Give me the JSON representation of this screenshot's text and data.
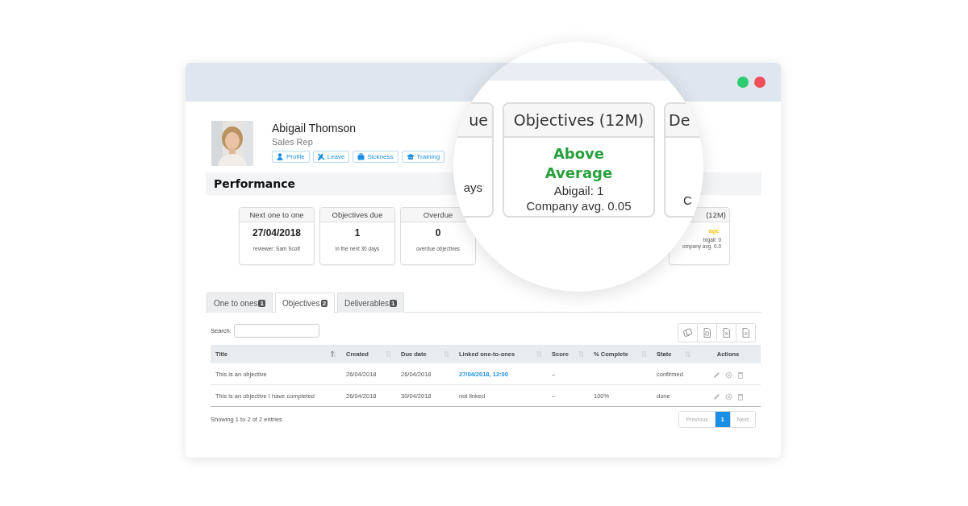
{
  "window": {
    "controls": [
      {
        "color": "#2ecc71"
      },
      {
        "color": "#f0505a"
      }
    ]
  },
  "profile": {
    "name": "Abigail Thomson",
    "role": "Sales Rep",
    "buttons": [
      {
        "label": "Profile"
      },
      {
        "label": "Leave"
      },
      {
        "label": "Sickness"
      },
      {
        "label": "Training"
      }
    ]
  },
  "performance": {
    "title": "Performance",
    "cards": [
      {
        "header": "Next one to one",
        "value": "27/04/2018",
        "note": "reviewer: Sam Scott"
      },
      {
        "header": "Objectives due",
        "value": "1",
        "note": "in the next 30 days"
      },
      {
        "header": "Overdue",
        "value": "0",
        "note": "overdue objectives"
      }
    ],
    "partial_card": {
      "header": "(12M)",
      "value": "age",
      "lines": [
        "bigail: 0",
        "ompany avg. 0.0"
      ]
    },
    "magnifier": {
      "left_card": {
        "header": "ue",
        "lines": [
          "ays"
        ]
      },
      "center_card": {
        "header": "Objectives (12M)",
        "value": "Above Average",
        "lines": [
          "Abigail: 1",
          "Company avg. 0.05"
        ]
      },
      "right_card": {
        "header": "De",
        "lines": [
          "C"
        ]
      }
    }
  },
  "tabs": [
    {
      "label": "One to ones",
      "count": "1",
      "selected": false
    },
    {
      "label": "Objectives",
      "count": "2",
      "selected": true
    },
    {
      "label": "Deliverables",
      "count": "1",
      "selected": false
    }
  ],
  "table": {
    "search_label": "Search:",
    "columns": [
      {
        "label": "Title",
        "sorted": true
      },
      {
        "label": "Created",
        "sorted": false
      },
      {
        "label": "Due date",
        "sorted": false
      },
      {
        "label": "Linked one-to-ones",
        "sorted": false
      },
      {
        "label": "Score",
        "sorted": false
      },
      {
        "label": "% Complete",
        "sorted": false
      },
      {
        "label": "State",
        "sorted": false
      },
      {
        "label": "Actions"
      }
    ],
    "rows": [
      {
        "title": "This is an objective",
        "created": "26/04/2018",
        "due": "26/04/2018",
        "linked": {
          "text": "27/04/2018, 12:00",
          "link": true
        },
        "score": "–",
        "state": "confirmed"
      },
      {
        "title": "This is an objective I have completed",
        "created": "26/04/2018",
        "due": "30/04/2018",
        "linked": {
          "text": "not linked",
          "link": false
        },
        "score": "–",
        "complete": "100%",
        "state": "done"
      }
    ],
    "info": "Showing 1 to 2 of 2 entries",
    "pagination": [
      {
        "label": "Previous",
        "selected": false
      },
      {
        "label": "1",
        "selected": true
      },
      {
        "label": "Next",
        "selected": false
      }
    ]
  }
}
